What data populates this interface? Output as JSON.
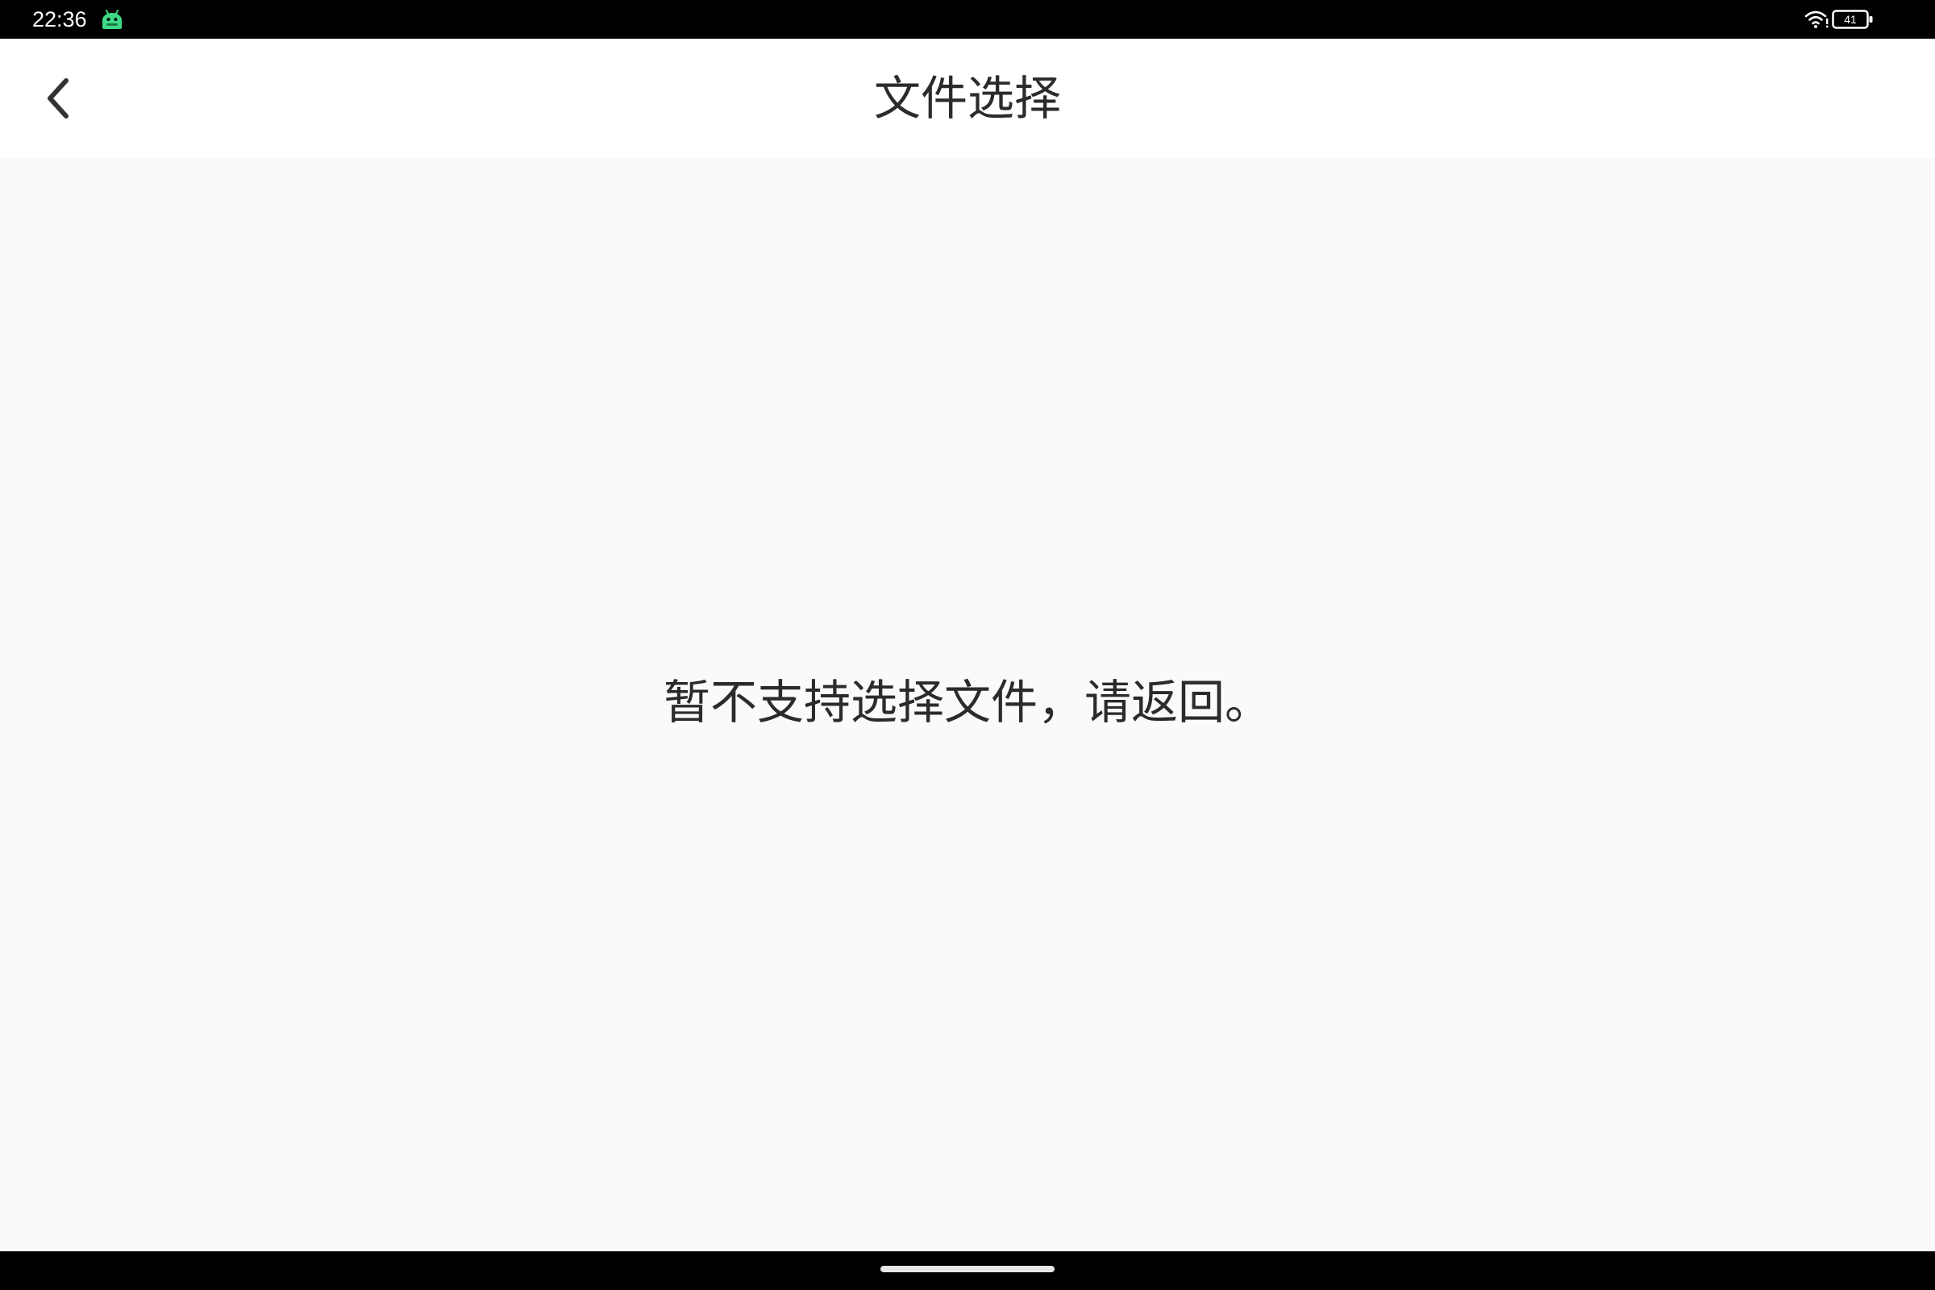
{
  "status_bar": {
    "time": "22:36",
    "app_icon": "android-robot-icon",
    "wifi_icon": "wifi-icon",
    "battery_icon": "battery-icon",
    "battery_level": "41"
  },
  "app_bar": {
    "back_icon": "chevron-left-icon",
    "title": "文件选择"
  },
  "main": {
    "message": "暂不支持选择文件，请返回。"
  },
  "nav_bar": {
    "home_indicator": "home-gesture-bar"
  },
  "colors": {
    "status_bar_bg": "#000000",
    "app_bar_bg": "#ffffff",
    "content_bg": "#fafafa",
    "text": "#2b2b2b",
    "app_icon_accent": "#3ddc84"
  }
}
